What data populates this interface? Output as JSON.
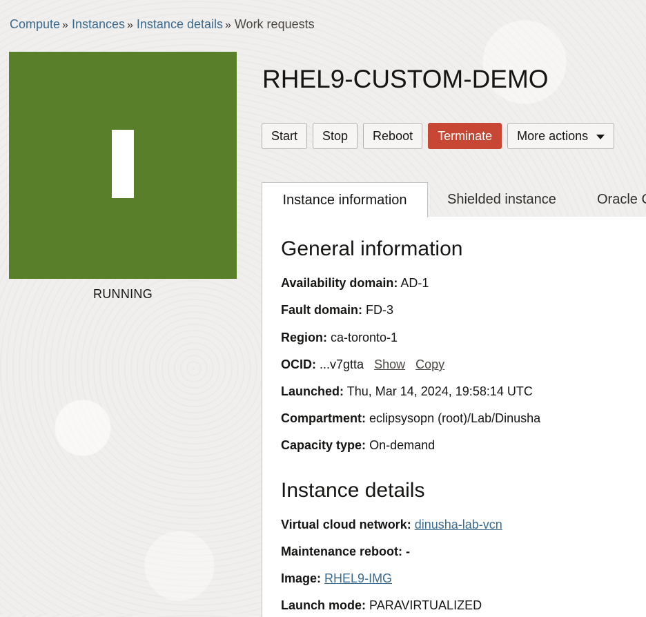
{
  "breadcrumb": {
    "items": [
      "Compute",
      "Instances",
      "Instance details"
    ],
    "separator": "»",
    "current": "Work requests"
  },
  "instance": {
    "tile_letter": "I",
    "tile_color": "#5a7f2a",
    "status": "RUNNING",
    "title": "RHEL9-CUSTOM-DEMO"
  },
  "actions": {
    "start": "Start",
    "stop": "Stop",
    "reboot": "Reboot",
    "terminate": "Terminate",
    "more": "More actions",
    "more_icon": "caret-down-icon",
    "danger_color": "#c74634"
  },
  "tabs": [
    {
      "label": "Instance information",
      "active": true
    },
    {
      "label": "Shielded instance",
      "active": false
    },
    {
      "label": "Oracle C",
      "active": false
    }
  ],
  "general": {
    "title": "General information",
    "availability_domain": {
      "label": "Availability domain:",
      "value": "AD-1"
    },
    "fault_domain": {
      "label": "Fault domain:",
      "value": "FD-3"
    },
    "region": {
      "label": "Region:",
      "value": "ca-toronto-1"
    },
    "ocid": {
      "label": "OCID:",
      "value": "...v7gtta",
      "show": "Show",
      "copy": "Copy"
    },
    "launched": {
      "label": "Launched:",
      "value": "Thu, Mar 14, 2024, 19:58:14 UTC"
    },
    "compartment": {
      "label": "Compartment:",
      "value": "eclipsysopn (root)/Lab/Dinusha"
    },
    "capacity_type": {
      "label": "Capacity type:",
      "value": "On-demand"
    }
  },
  "details": {
    "title": "Instance details",
    "vcn": {
      "label": "Virtual cloud network:",
      "value": "dinusha-lab-vcn"
    },
    "maintenance_reboot": {
      "label": "Maintenance reboot:",
      "value": "-"
    },
    "image": {
      "label": "Image:",
      "value": "RHEL9-IMG"
    },
    "launch_mode": {
      "label": "Launch mode:",
      "value": "PARAVIRTUALIZED"
    }
  }
}
